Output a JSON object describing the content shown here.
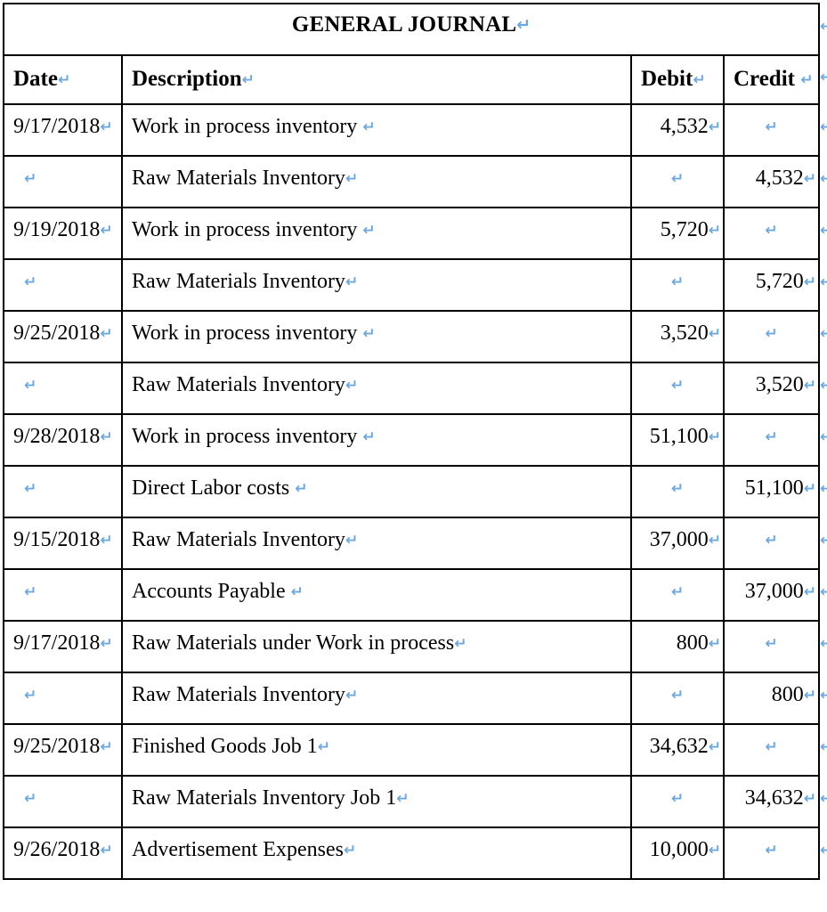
{
  "document": {
    "title": "GENERAL JOURNAL",
    "mark": "↵",
    "mark_color": "#6fa8dc"
  },
  "table": {
    "columns": [
      {
        "key": "date",
        "label": "Date",
        "align": "left"
      },
      {
        "key": "description",
        "label": "Description",
        "align": "left"
      },
      {
        "key": "debit",
        "label": "Debit",
        "align": "right"
      },
      {
        "key": "credit",
        "label": "Credit",
        "align": "right"
      }
    ],
    "rows": [
      {
        "date": "9/17/2018",
        "description": "Work in process inventory ",
        "debit": "4,532",
        "credit": ""
      },
      {
        "date": "",
        "description": "Raw Materials Inventory",
        "debit": "",
        "credit": "4,532"
      },
      {
        "date": "9/19/2018",
        "description": "Work in process inventory ",
        "debit": "5,720",
        "credit": ""
      },
      {
        "date": "",
        "description": "Raw Materials Inventory",
        "debit": "",
        "credit": "5,720"
      },
      {
        "date": "9/25/2018",
        "description": "Work in process inventory ",
        "debit": "3,520",
        "credit": ""
      },
      {
        "date": "",
        "description": "Raw Materials Inventory",
        "debit": "",
        "credit": "3,520"
      },
      {
        "date": "9/28/2018",
        "description": "Work in process inventory ",
        "debit": "51,100",
        "credit": ""
      },
      {
        "date": "",
        "description": "Direct Labor costs ",
        "debit": "",
        "credit": "51,100"
      },
      {
        "date": "9/15/2018",
        "description": "Raw Materials Inventory",
        "debit": "37,000",
        "credit": ""
      },
      {
        "date": "",
        "description": "Accounts Payable ",
        "debit": "",
        "credit": "37,000"
      },
      {
        "date": "9/17/2018",
        "description": "Raw Materials under Work in process",
        "debit": "800",
        "credit": ""
      },
      {
        "date": "",
        "description": "Raw Materials Inventory",
        "debit": "",
        "credit": "800"
      },
      {
        "date": "9/25/2018",
        "description": "Finished Goods Job 1",
        "debit": "34,632",
        "credit": ""
      },
      {
        "date": "",
        "description": "Raw Materials Inventory Job 1",
        "debit": "",
        "credit": "34,632"
      },
      {
        "date": "9/26/2018",
        "description": "Advertisement Expenses",
        "debit": "10,000",
        "credit": ""
      }
    ]
  }
}
